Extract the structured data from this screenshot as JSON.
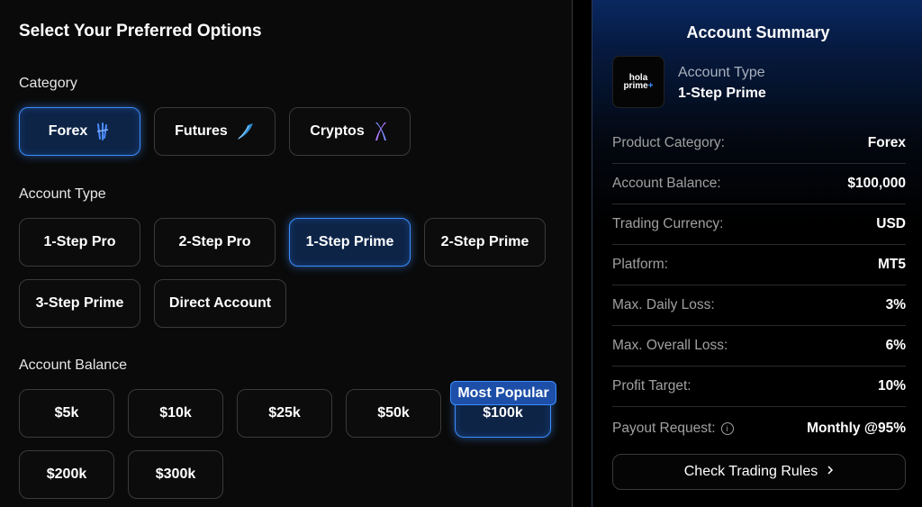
{
  "left": {
    "title": "Select Your Preferred Options",
    "category_label": "Category",
    "categories": [
      {
        "label": "Forex",
        "icon": "forex-icon",
        "selected": true
      },
      {
        "label": "Futures",
        "icon": "futures-icon",
        "selected": false
      },
      {
        "label": "Cryptos",
        "icon": "cryptos-icon",
        "selected": false
      }
    ],
    "account_type_label": "Account Type",
    "account_types": [
      {
        "label": "1-Step Pro",
        "selected": false
      },
      {
        "label": "2-Step Pro",
        "selected": false
      },
      {
        "label": "1-Step Prime",
        "selected": true
      },
      {
        "label": "2-Step Prime",
        "selected": false
      },
      {
        "label": "3-Step Prime",
        "selected": false
      },
      {
        "label": "Direct Account",
        "selected": false
      }
    ],
    "account_balance_label": "Account Balance",
    "balances": [
      {
        "label": "$5k",
        "selected": false
      },
      {
        "label": "$10k",
        "selected": false
      },
      {
        "label": "$25k",
        "selected": false
      },
      {
        "label": "$50k",
        "selected": false
      },
      {
        "label": "$100k",
        "selected": true
      },
      {
        "label": "$200k",
        "selected": false
      },
      {
        "label": "$300k",
        "selected": false
      }
    ],
    "popular_badge": "Most Popular"
  },
  "summary": {
    "title": "Account Summary",
    "logo_text_1": "hola",
    "logo_text_2": "prime",
    "account_type_label": "Account Type",
    "account_type_value": "1-Step Prime",
    "rows": [
      {
        "key": "Product Category:",
        "value": "Forex"
      },
      {
        "key": "Account Balance:",
        "value": "$100,000"
      },
      {
        "key": "Trading Currency:",
        "value": "USD"
      },
      {
        "key": "Platform:",
        "value": "MT5"
      },
      {
        "key": "Max. Daily Loss:",
        "value": "3%"
      },
      {
        "key": "Max. Overall Loss:",
        "value": "6%"
      },
      {
        "key": "Profit Target:",
        "value": "10%"
      },
      {
        "key": "Payout Request:",
        "value": "Monthly @95%"
      }
    ],
    "rules_button": "Check Trading Rules"
  },
  "colors": {
    "accent": "#3b8cff",
    "selected_bg": "#0d2447",
    "border": "#3a3a3a"
  }
}
